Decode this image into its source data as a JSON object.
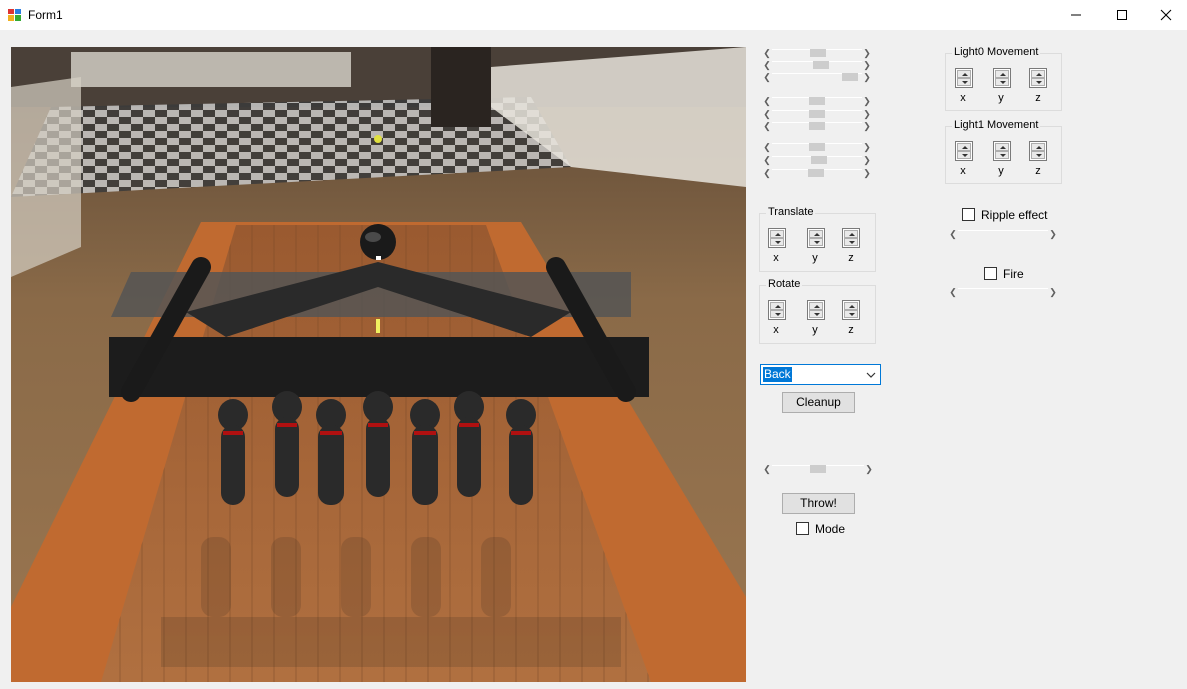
{
  "window": {
    "title": "Form1"
  },
  "transform": {
    "translate": {
      "title": "Translate",
      "axes": [
        "x",
        "y",
        "z"
      ]
    },
    "rotate": {
      "title": "Rotate",
      "axes": [
        "x",
        "y",
        "z"
      ]
    }
  },
  "lights": {
    "light0": {
      "title": "Light0 Movement",
      "axes": [
        "x",
        "y",
        "z"
      ]
    },
    "light1": {
      "title": "Light1 Movement",
      "axes": [
        "x",
        "y",
        "z"
      ]
    }
  },
  "effects": {
    "ripple_label": "Ripple effect",
    "ripple_checked": false,
    "fire_label": "Fire",
    "fire_checked": false
  },
  "camera_combo": {
    "selected": "Back"
  },
  "buttons": {
    "cleanup": "Cleanup",
    "throw": "Throw!"
  },
  "mode": {
    "label": "Mode",
    "checked": false
  },
  "scene": {
    "ball_color": "#1a1a1a",
    "pin_color": "#2a2a2a",
    "pin_stripe_color": "#b01010",
    "lane_color": "#a86a3a",
    "gutter_color": "#b8622a"
  }
}
